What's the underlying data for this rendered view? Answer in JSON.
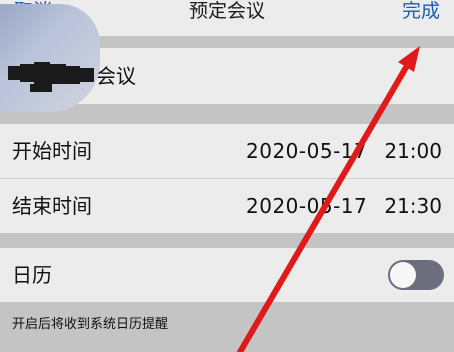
{
  "nav": {
    "cancel": "取消",
    "title": "预定会议",
    "done": "完成"
  },
  "name_row": {
    "suffix": "会议"
  },
  "start": {
    "label": "开始时间",
    "date": "2020-05-17",
    "time": "21:00"
  },
  "end": {
    "label": "结束时间",
    "date": "2020-05-17",
    "time": "21:30"
  },
  "calendar": {
    "label": "日历",
    "enabled": false
  },
  "footer": {
    "note": "开启后将收到系统日历提醒"
  },
  "colors": {
    "accent": "#1e5bb8",
    "annotation": "#e01a1a"
  }
}
